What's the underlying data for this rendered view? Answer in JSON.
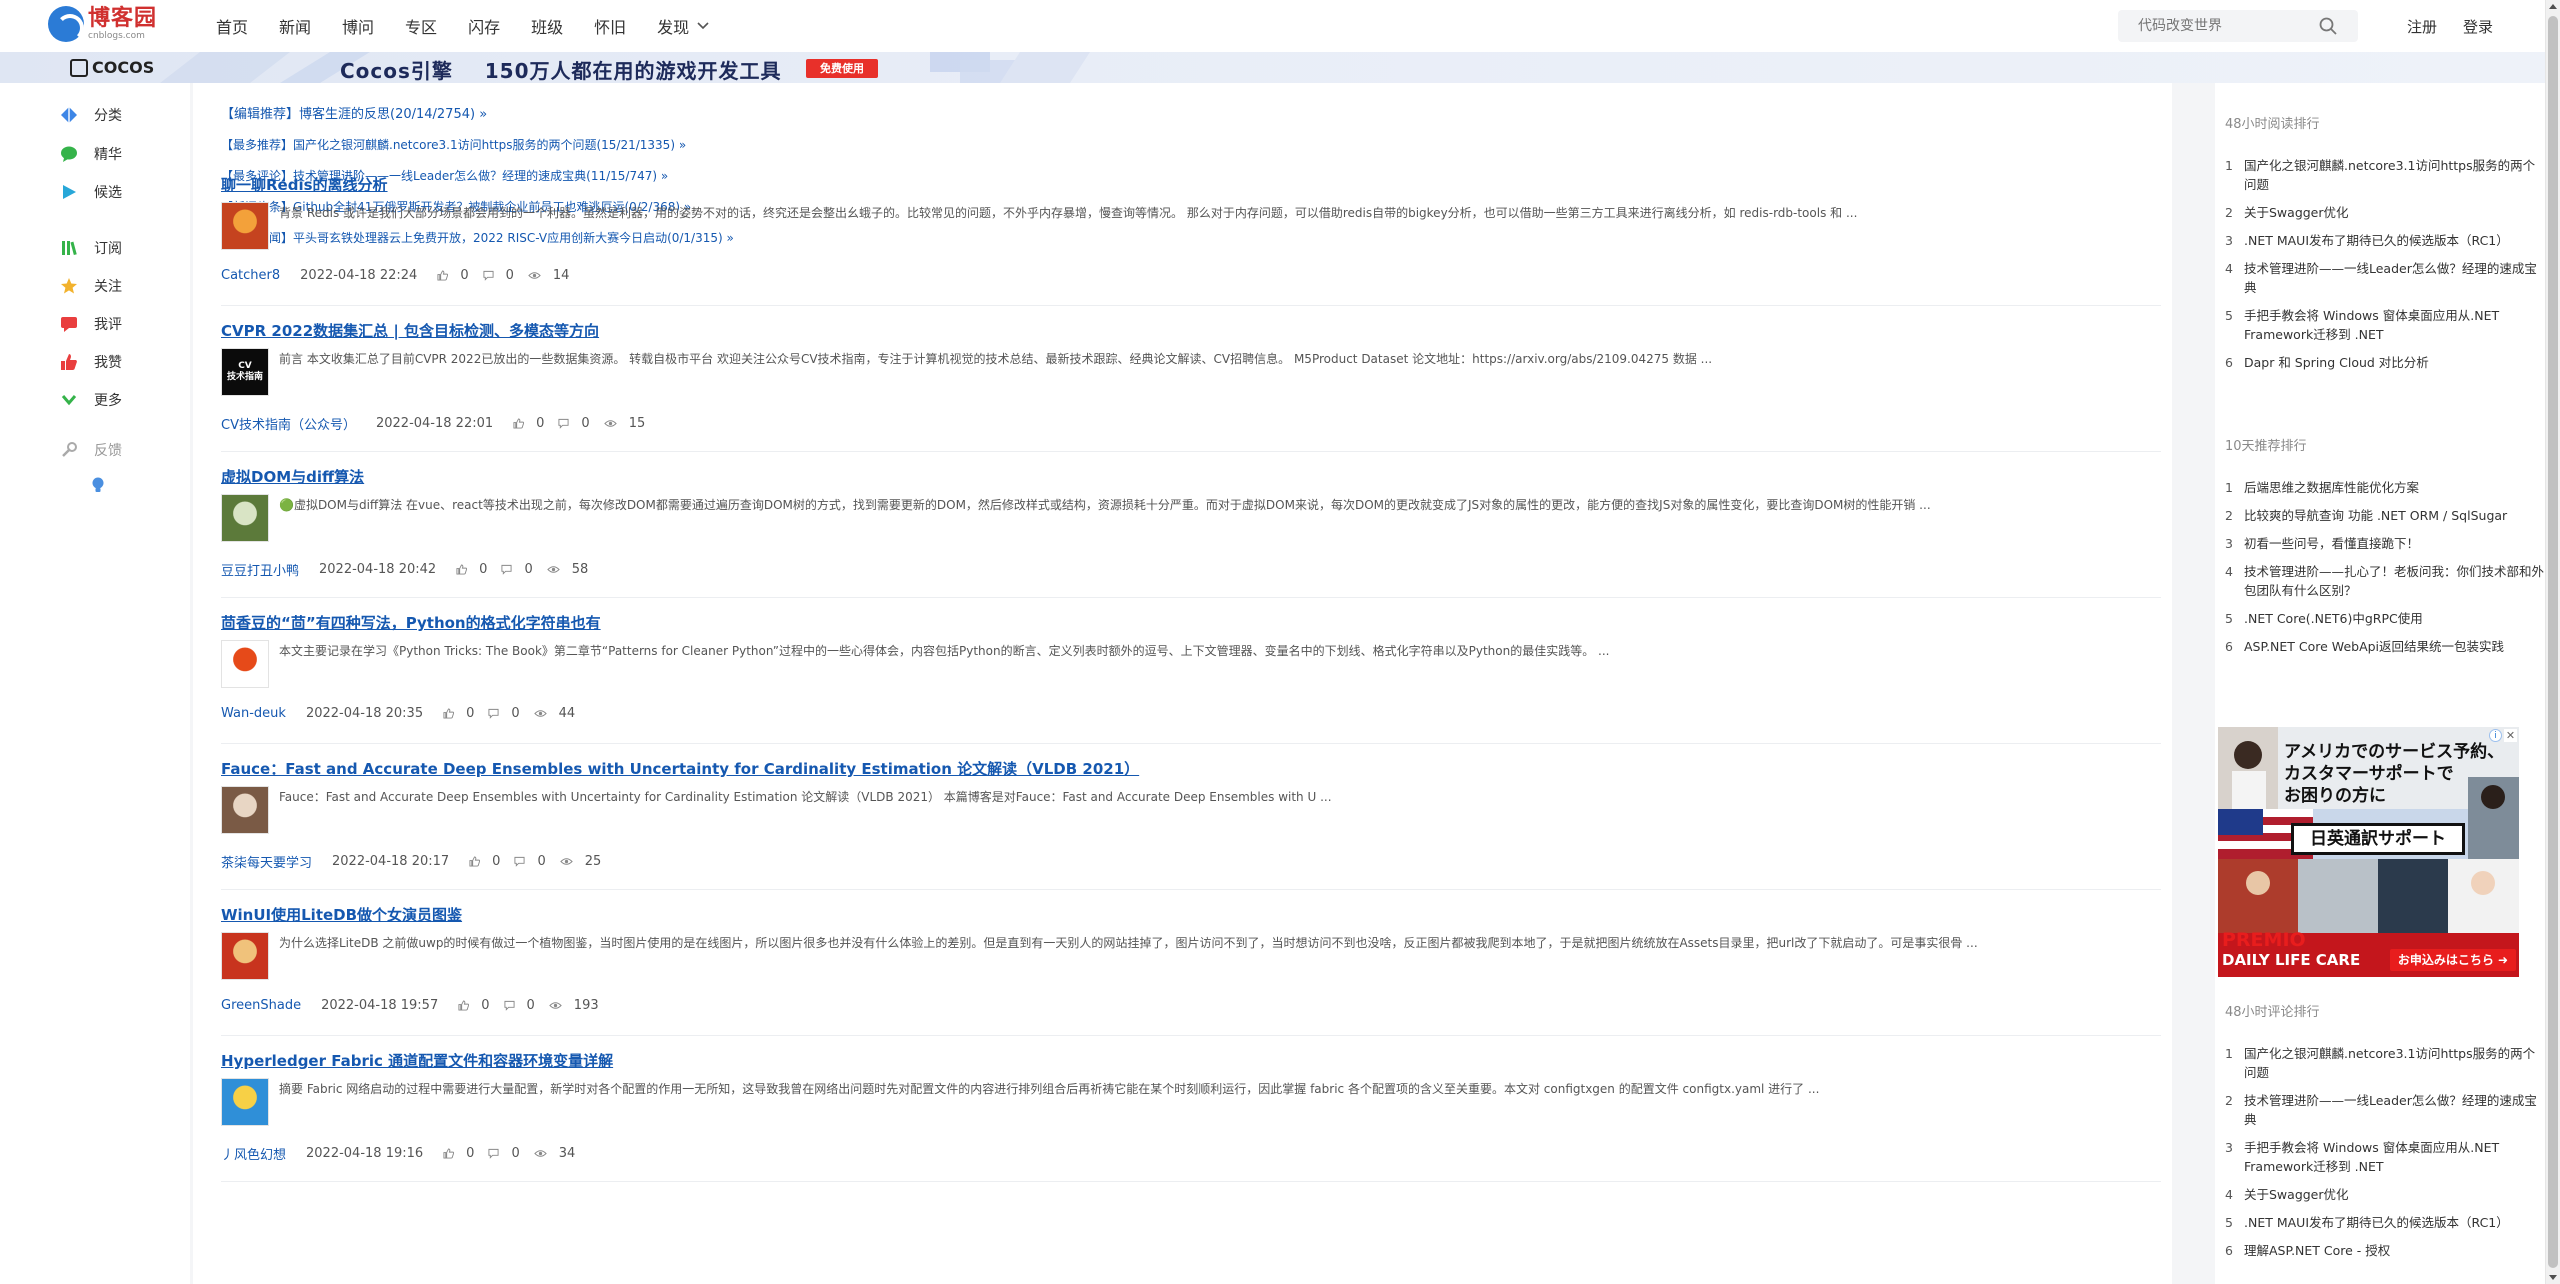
{
  "logo": {
    "name": "博客园",
    "sub": "cnblogs.com"
  },
  "nav": [
    "首页",
    "新闻",
    "博问",
    "专区",
    "闪存",
    "班级",
    "怀旧"
  ],
  "nav_more": "发现",
  "search": {
    "placeholder": "代码改变世界"
  },
  "auth": {
    "register": "注册",
    "login": "登录"
  },
  "banner": {
    "brand": "COCOS",
    "slogan": "Cocos引擎    150万人都在用的游戏开发工具",
    "button": "免费使用"
  },
  "sidebar": [
    {
      "label": "分类",
      "icon": "diamond-icon",
      "color": "#3d86e6"
    },
    {
      "label": "精华",
      "icon": "bubble-icon",
      "color": "#35b34a"
    },
    {
      "label": "候选",
      "icon": "play-icon",
      "color": "#28a7d8"
    },
    {
      "label": "订阅",
      "icon": "books-icon",
      "color": "#35b34a"
    },
    {
      "label": "关注",
      "icon": "star-icon",
      "color": "#f2b22d"
    },
    {
      "label": "我评",
      "icon": "comment-icon",
      "color": "#e93e3e"
    },
    {
      "label": "我赞",
      "icon": "thumb-icon",
      "color": "#e93e3e"
    },
    {
      "label": "更多",
      "icon": "chevron-icon",
      "color": "#35b34a"
    },
    {
      "label": "反馈",
      "icon": "wrench-icon",
      "color": "#aaaaaa"
    }
  ],
  "pins": [
    "【编辑推荐】博客生涯的反思(20/14/2754) »",
    "【最多推荐】国产化之银河麒麟.netcore3.1访问https服务的两个问题(15/21/1335) »",
    "【最多评论】技术管理进阶——一线Leader怎么做？经理的速成宝典(11/15/747) »",
    "【新闻头条】Github全封41万俄罗斯开发者？被制裁企业前员工也难逃厄运(0/2/368) »",
    "【推荐新闻】平头哥玄铁处理器云上免费开放，2022 RISC-V应用创新大赛今日启动(0/1/315) »"
  ],
  "posts": [
    {
      "title": "聊一聊Redis的离线分析",
      "summary": "背景 Redis 或许是我们大部分场景都会用到的一个利器。虽然是利器，用的姿势不对的话，终究还是会整出幺蛾子的。比较常见的问题，不外乎内存暴增，慢查询等情况。 那么对于内存问题，可以借助redis自带的bigkey分析，也可以借助一些第三方工具来进行离线分析，如 redis-rdb-tools 和 ...",
      "author": "Catcher8",
      "date": "2022-04-18 22:24",
      "likes": "0",
      "comments": "0",
      "views": "14",
      "avatar_colors": [
        "#c5431f",
        "#f3a13a"
      ]
    },
    {
      "title": "CVPR 2022数据集汇总 | 包含目标检测、多模态等方向",
      "summary": "前言 本文收集汇总了目前CVPR 2022已放出的一些数据集资源。 转载自极市平台 欢迎关注公众号CV技术指南，专注于计算机视觉的技术总结、最新技术跟踪、经典论文解读、CV招聘信息。 M5Product Dataset 论文地址：https://arxiv.org/abs/2109.04275 数据 ...",
      "author": "CV技术指南（公众号）",
      "date": "2022-04-18 22:01",
      "likes": "0",
      "comments": "0",
      "views": "15",
      "avatar_colors": [
        "#0b0b0b",
        "#ffffff"
      ],
      "avatar_text": "CV\n技术指南"
    },
    {
      "title": "虚拟DOM与diff算法",
      "summary": "🟢虚拟DOM与diff算法 在vue、react等技术出现之前，每次修改DOM都需要通过遍历查询DOM树的方式，找到需要更新的DOM，然后修改样式或结构，资源损耗十分严重。而对于虚拟DOM来说，每次DOM的更改就变成了JS对象的属性的更改，能方便的查找JS对象的属性变化，要比查询DOM树的性能开销 ...",
      "author": "豆豆打丑小鸭",
      "date": "2022-04-18 20:42",
      "likes": "0",
      "comments": "0",
      "views": "58",
      "avatar_colors": [
        "#5c7a3a",
        "#d9e4c5"
      ]
    },
    {
      "title": "茴香豆的“茴”有四种写法，Python的格式化字符串也有",
      "summary": "本文主要记录在学习《Python Tricks: The Book》第二章节“Patterns for Cleaner Python”过程中的一些心得体会，内容包括Python的断言、定义列表时额外的逗号、上下文管理器、变量名中的下划线、格式化字符串以及Python的最佳实践等。 ...",
      "author": "Wan-deuk",
      "date": "2022-04-18 20:35",
      "likes": "0",
      "comments": "0",
      "views": "44",
      "avatar_colors": [
        "#ffffff",
        "#e64a19"
      ]
    },
    {
      "title": "Fauce：Fast and Accurate Deep Ensembles with Uncertainty for Cardinality Estimation 论文解读（VLDB 2021）",
      "summary": "Fauce：Fast and Accurate Deep Ensembles with Uncertainty for Cardinality Estimation 论文解读（VLDB 2021） 本篇博客是对Fauce：Fast and Accurate Deep Ensembles with U ...",
      "author": "茶柒每天要学习",
      "date": "2022-04-18 20:17",
      "likes": "0",
      "comments": "0",
      "views": "25",
      "avatar_colors": [
        "#7a5a45",
        "#e8d6c4"
      ]
    },
    {
      "title": "WinUI使用LiteDB做个女演员图鉴",
      "summary": "为什么选择LiteDB 之前做uwp的时候有做过一个植物图鉴，当时图片使用的是在线图片，所以图片很多也并没有什么体验上的差别。但是直到有一天别人的网站挂掉了，图片访问不到了，当时想访问不到也没啥，反正图片都被我爬到本地了，于是就把图片统统放在Assets目录里，把url改了下就启动了。可是事实很骨 ...",
      "author": "GreenShade",
      "date": "2022-04-18 19:57",
      "likes": "0",
      "comments": "0",
      "views": "193",
      "avatar_colors": [
        "#c8341e",
        "#f0c27b"
      ]
    },
    {
      "title": "Hyperledger Fabric 通道配置文件和容器环境变量详解",
      "summary": "摘要 Fabric 网络启动的过程中需要进行大量配置，新学时对各个配置的作用一无所知，这导致我曾在网络出问题时先对配置文件的内容进行排列组合后再祈祷它能在某个时刻顺利运行，因此掌握 fabric 各个配置项的含义至关重要。本文对 configtxgen 的配置文件 configtx.yaml 进行了 ...",
      "author": "丿风色幻想",
      "date": "2022-04-18 19:16",
      "likes": "0",
      "comments": "0",
      "views": "34",
      "avatar_colors": [
        "#2f8fd8",
        "#f7d046"
      ]
    }
  ],
  "right": {
    "rank1": {
      "title": "48小时阅读排行",
      "items": [
        "国产化之银河麒麟.netcore3.1访问https服务的两个问题",
        "关于Swagger优化",
        ".NET MAUI发布了期待已久的候选版本（RC1）",
        "技术管理进阶——一线Leader怎么做？经理的速成宝典",
        "手把手教会将 Windows 窗体桌面应用从.NET Framework迁移到 .NET",
        "Dapr 和 Spring Cloud 对比分析"
      ]
    },
    "rank2": {
      "title": "10天推荐排行",
      "items": [
        "后端思维之数据库性能优化方案",
        "比较爽的导航查询 功能 .NET ORM / SqlSugar",
        "初看一些问号，看懂直接跪下！",
        "技术管理进阶——扎心了！老板问我：你们技术部和外包团队有什么区别？",
        ".NET Core(.NET6)中gRPC使用",
        "ASP.NET Core WebApi返回结果统一包装实践"
      ]
    },
    "ad": {
      "line1": "アメリカでのサービス予約、",
      "line2": "カスタマーサポートで",
      "line3": "お困りの方に",
      "box": "日英通訳サポート",
      "premio": "PREMIO",
      "dlc": "DAILY LIFE CARE",
      "cta": "お申込みはこちら ➜",
      "info": "i",
      "close": "✕"
    },
    "rank3": {
      "title": "48小时评论排行",
      "items": [
        "国产化之银河麒麟.netcore3.1访问https服务的两个问题",
        "技术管理进阶——一线Leader怎么做？经理的速成宝典",
        "手把手教会将 Windows 窗体桌面应用从.NET Framework迁移到 .NET",
        "关于Swagger优化",
        ".NET MAUI发布了期待已久的候选版本（RC1）",
        "理解ASP.NET Core - 授权"
      ]
    }
  }
}
